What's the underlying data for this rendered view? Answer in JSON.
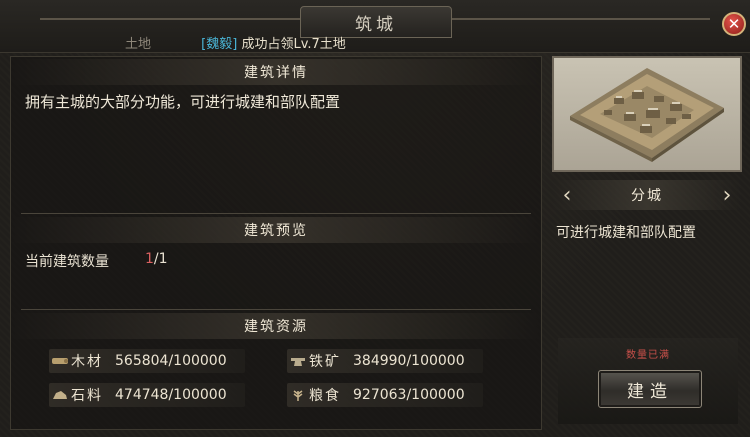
{
  "header": {
    "title": "筑城",
    "close_symbol": "✕",
    "land_label": "土地",
    "owner_faction": "[魏毅]",
    "owner_message": "成功占领Lv.7土地"
  },
  "details": {
    "heading": "建筑详情",
    "description": "拥有主城的大部分功能，可进行城建和部队配置"
  },
  "preview": {
    "heading": "建筑预览",
    "count_label": "当前建筑数量",
    "count_current": "1",
    "count_separator": "/",
    "count_max": "1"
  },
  "resources": {
    "heading": "建筑资源",
    "items": [
      {
        "name": "木材",
        "value": "565804/100000",
        "icon": "wood-icon"
      },
      {
        "name": "铁矿",
        "value": "384990/100000",
        "icon": "iron-icon"
      },
      {
        "name": "石料",
        "value": "474748/100000",
        "icon": "stone-icon"
      },
      {
        "name": "粮食",
        "value": "927063/100000",
        "icon": "grain-icon"
      }
    ]
  },
  "side": {
    "building_name": "分城",
    "building_desc": "可进行城建和部队配置",
    "limit_text": "数量已满",
    "build_button": "建造",
    "prev_arrow": "‹",
    "next_arrow": "›"
  },
  "colors": {
    "faction": "#4ab5d6",
    "count_current": "#d96060",
    "limit_text": "#c8504a",
    "close_button": "#c2302a"
  }
}
